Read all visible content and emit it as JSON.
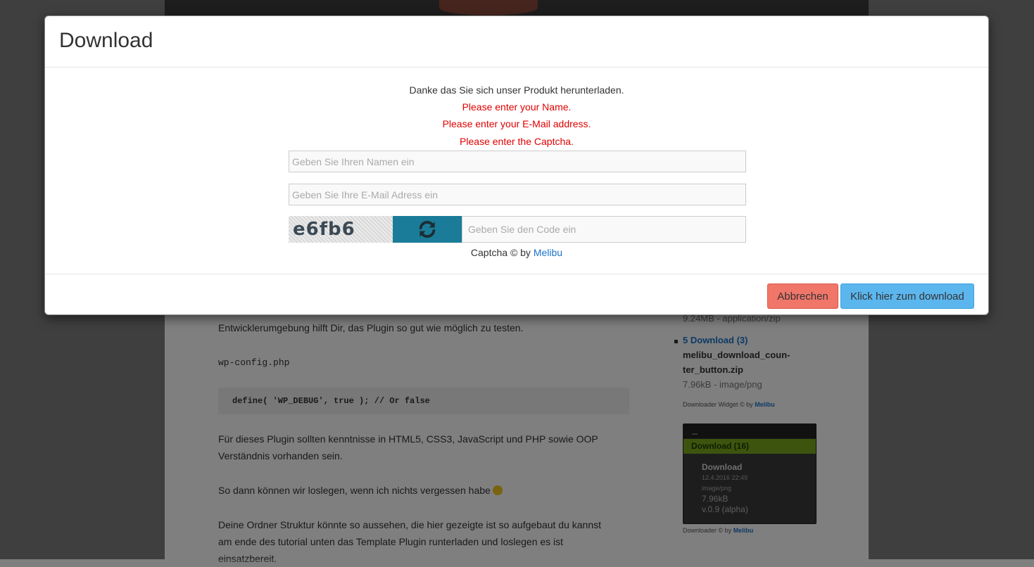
{
  "background": {
    "article": {
      "p1": "Entwicklerumgebung hilft Dir, das Plugin so gut wie möglich zu testen.",
      "code_label": "wp-config.php",
      "code": "define( 'WP_DEBUG', true ); // Or false",
      "p2_line1": "Für dieses Plugin sollten kenntnisse in HTML5, CSS3, JavaScript und PHP sowie OOP",
      "p2_line2": "Verständnis vorhanden sein.",
      "p3": "So dann können wir loslegen, wenn ich nichts vergessen habe",
      "p4_line1": "Deine Ordner Struktur könnte so aussehen, die hier gezeigte ist so aufgebaut du kannst",
      "p4_line2": "am ende des tutorial unten das Template Plugin runterladen und loslegen es ist",
      "p4_line3": "einsatzbereit."
    },
    "sidebar": {
      "item4_meta": "9.24MB - application/zip",
      "item5_num": "5",
      "item5_link": "Download (3)",
      "item5_file_line1": "melibu_download_coun-",
      "item5_file_line2": "ter_button.zip",
      "item5_meta": "7.96kB - image/png",
      "credit1_text": "Downloader Widget © by",
      "credit1_link": "Melibu",
      "widget": {
        "button": "Download (16)",
        "title": "Download",
        "date": "12.4.2016 22:49",
        "mime": "image/png",
        "size": "7.96kB",
        "version": "v.0.9 (alpha)"
      },
      "credit2_text": "Downloader © by",
      "credit2_link": "Melibu"
    }
  },
  "modal": {
    "title": "Download",
    "thanks": "Danke das Sie sich unser Produkt herunterladen.",
    "errors": {
      "name": "Please enter your Name.",
      "email": "Please enter your E-Mail address.",
      "captcha": "Please enter the Captcha."
    },
    "name_field": {
      "value": "",
      "placeholder": "Geben Sie Ihren Namen ein"
    },
    "email_field": {
      "value": "",
      "placeholder": "Geben Sie Ihre E-Mail Adress ein"
    },
    "captcha": {
      "code": "e6fb6",
      "refresh_icon": "refresh-icon",
      "placeholder": "Geben Sie den Code ein",
      "credit_text": "Captcha © by",
      "credit_link": "Melibu"
    },
    "buttons": {
      "cancel": "Abbrechen",
      "download": "Klick hier zum download"
    }
  },
  "colors": {
    "error": "#e00000",
    "link": "#1a73c9",
    "cancel_bg": "#f0766a",
    "download_bg": "#5cb6ee",
    "captcha_refresh_bg": "#1a7c98",
    "widget_green": "#7aa81e"
  }
}
